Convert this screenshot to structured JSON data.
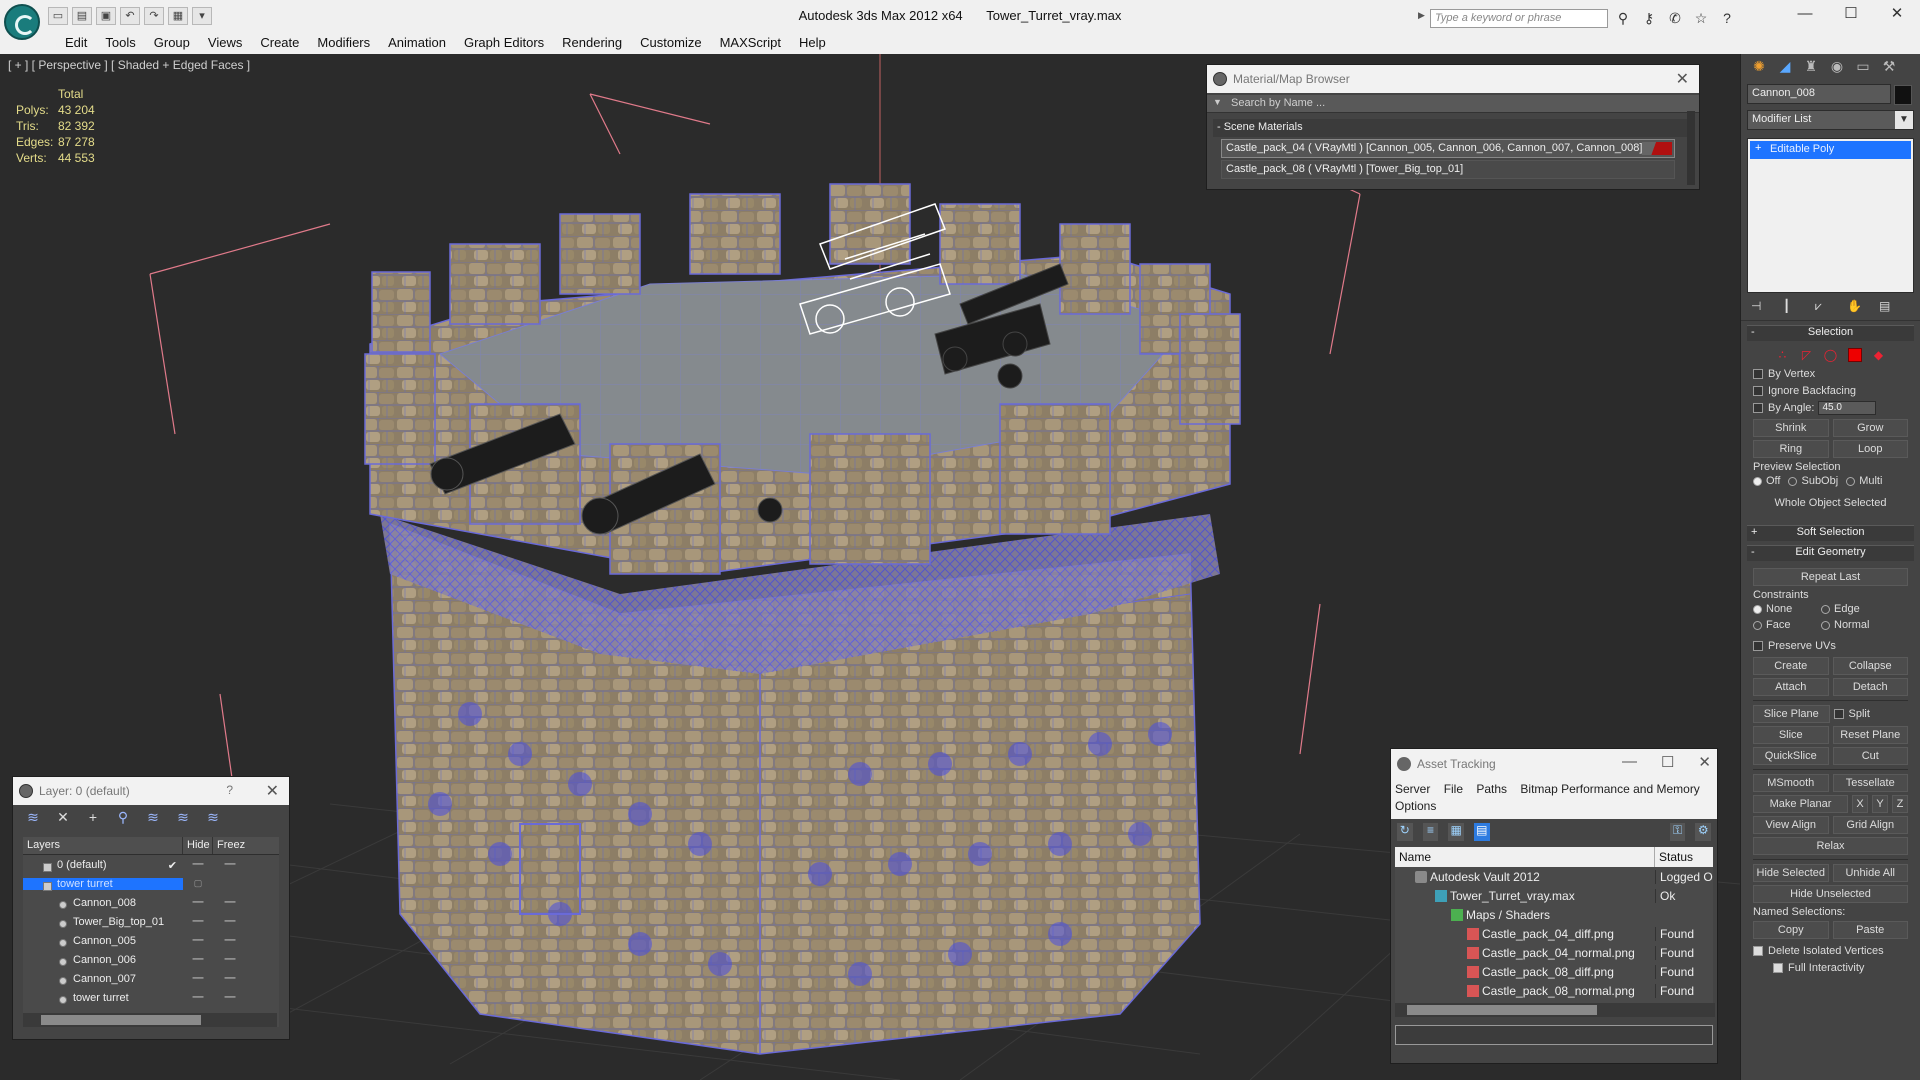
{
  "titlebar": {
    "app": "Autodesk 3ds Max  2012 x64",
    "file": "Tower_Turret_vray.max",
    "search_placeholder": "Type a keyword or phrase"
  },
  "menu": [
    "Edit",
    "Tools",
    "Group",
    "Views",
    "Create",
    "Modifiers",
    "Animation",
    "Graph Editors",
    "Rendering",
    "Customize",
    "MAXScript",
    "Help"
  ],
  "viewport": {
    "label": "[ + ] [ Perspective ] [ Shaded + Edged Faces ]",
    "stats": {
      "header": "Total",
      "polys_label": "Polys:",
      "polys": "43 204",
      "tris_label": "Tris:",
      "tris": "82 392",
      "edges_label": "Edges:",
      "edges": "87 278",
      "verts_label": "Verts:",
      "verts": "44 553"
    }
  },
  "material_browser": {
    "title": "Material/Map Browser",
    "search": "Search by Name ...",
    "group": "- Scene Materials",
    "items": [
      "Castle_pack_04  ( VRayMtl )  [Cannon_005, Cannon_006, Cannon_007, Cannon_008]",
      "Castle_pack_08  ( VRayMtl )  [Tower_Big_top_01]"
    ]
  },
  "layer_panel": {
    "title": "Layer: 0 (default)",
    "help": "?",
    "col_layers": "Layers",
    "col_hide": "Hide",
    "col_freeze": "Freez",
    "rows": [
      {
        "name": "0 (default)"
      },
      {
        "name": "tower turret"
      },
      {
        "name": "Cannon_008"
      },
      {
        "name": "Tower_Big_top_01"
      },
      {
        "name": "Cannon_005"
      },
      {
        "name": "Cannon_006"
      },
      {
        "name": "Cannon_007"
      },
      {
        "name": "tower turret"
      }
    ]
  },
  "asset_tracking": {
    "title": "Asset Tracking",
    "menu": [
      "Server",
      "File",
      "Paths",
      "Bitmap Performance and Memory",
      "Options"
    ],
    "col_name": "Name",
    "col_status": "Status",
    "rows": [
      {
        "name": "Autodesk Vault 2012",
        "status": "Logged O"
      },
      {
        "name": "Tower_Turret_vray.max",
        "status": "Ok"
      },
      {
        "name": "Maps / Shaders",
        "status": ""
      },
      {
        "name": "Castle_pack_04_diff.png",
        "status": "Found"
      },
      {
        "name": "Castle_pack_04_normal.png",
        "status": "Found"
      },
      {
        "name": "Castle_pack_08_diff.png",
        "status": "Found"
      },
      {
        "name": "Castle_pack_08_normal.png",
        "status": "Found"
      }
    ]
  },
  "command_panel": {
    "object_name": "Cannon_008",
    "modifier_list": "Modifier List",
    "stack_item": "Editable Poly",
    "selection": {
      "title": "Selection",
      "by_vertex": "By Vertex",
      "ignore_backfacing": "Ignore Backfacing",
      "by_angle": "By Angle:",
      "angle_value": "45.0",
      "shrink": "Shrink",
      "grow": "Grow",
      "ring": "Ring",
      "loop": "Loop",
      "preview_selection": "Preview Selection",
      "off": "Off",
      "subobj": "SubObj",
      "multi": "Multi",
      "status": "Whole Object Selected"
    },
    "soft_selection": "Soft Selection",
    "edit_geometry": {
      "title": "Edit Geometry",
      "repeat_last": "Repeat Last",
      "constraints": "Constraints",
      "none": "None",
      "edge": "Edge",
      "face": "Face",
      "normal": "Normal",
      "preserve_uvs": "Preserve UVs",
      "create": "Create",
      "collapse": "Collapse",
      "attach": "Attach",
      "detach": "Detach",
      "slice_plane": "Slice Plane",
      "split": "Split",
      "slice": "Slice",
      "reset_plane": "Reset Plane",
      "quickslice": "QuickSlice",
      "cut": "Cut",
      "msmooth": "MSmooth",
      "tessellate": "Tessellate",
      "make_planar": "Make Planar",
      "x": "X",
      "y": "Y",
      "z": "Z",
      "view_align": "View Align",
      "grid_align": "Grid Align",
      "relax": "Relax",
      "hide_selected": "Hide Selected",
      "unhide_all": "Unhide All",
      "hide_unselected": "Hide Unselected",
      "named_selections": "Named Selections:",
      "copy": "Copy",
      "paste": "Paste",
      "delete_isolated": "Delete Isolated Vertices",
      "full_interactivity": "Full Interactivity"
    }
  }
}
